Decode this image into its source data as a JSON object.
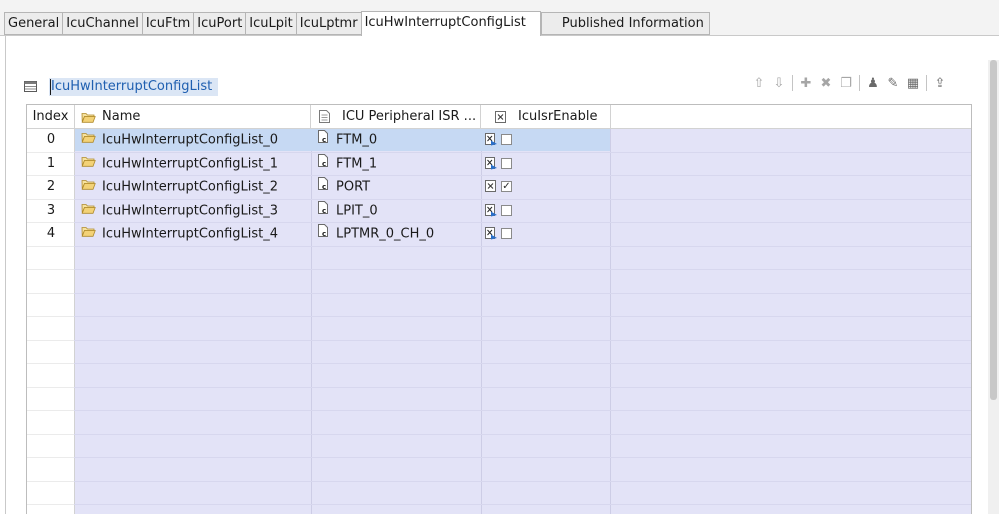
{
  "tabs": [
    {
      "label": "General",
      "active": false
    },
    {
      "label": "IcuChannel",
      "active": false
    },
    {
      "label": "IcuFtm",
      "active": false
    },
    {
      "label": "IcuPort",
      "active": false
    },
    {
      "label": "IcuLpit",
      "active": false
    },
    {
      "label": "IcuLptmr",
      "active": false
    },
    {
      "label": "IcuHwInterruptConfigList",
      "active": true
    },
    {
      "label": "Published Information",
      "active": false
    }
  ],
  "section": {
    "title": "IcuHwInterruptConfigList",
    "icon": "table-icon"
  },
  "toolbar": [
    {
      "icon": "arrow-up-icon",
      "glyph": "⇧",
      "enabled": false
    },
    {
      "icon": "arrow-down-icon",
      "glyph": "⇩",
      "enabled": false
    },
    {
      "icon": "add-icon",
      "glyph": "✚",
      "enabled": false
    },
    {
      "icon": "delete-icon",
      "glyph": "✖",
      "enabled": false
    },
    {
      "icon": "copy-icon",
      "glyph": "❐",
      "enabled": false
    },
    {
      "icon": "user-icon",
      "glyph": "♟",
      "enabled": true
    },
    {
      "icon": "edit-icon",
      "glyph": "✎",
      "enabled": true
    },
    {
      "icon": "edit-table-icon",
      "glyph": "▦",
      "enabled": true
    },
    {
      "icon": "export-icon",
      "glyph": "⇪",
      "enabled": true
    }
  ],
  "table": {
    "columns": {
      "index": "Index",
      "name": "Name",
      "isr": "ICU Peripheral ISR ...",
      "enable": "IcuIsrEnable"
    },
    "rows": [
      {
        "index": "0",
        "name": "IcuHwInterruptConfigList_0",
        "isr": "FTM_0",
        "enabled": false
      },
      {
        "index": "1",
        "name": "IcuHwInterruptConfigList_1",
        "isr": "FTM_1",
        "enabled": false
      },
      {
        "index": "2",
        "name": "IcuHwInterruptConfigList_2",
        "isr": "PORT",
        "enabled": true
      },
      {
        "index": "3",
        "name": "IcuHwInterruptConfigList_3",
        "isr": "LPIT_0",
        "enabled": false
      },
      {
        "index": "4",
        "name": "IcuHwInterruptConfigList_4",
        "isr": "LPTMR_0_CH_0",
        "enabled": false
      }
    ],
    "selected_row": 0
  },
  "colors": {
    "selection": "#c6d9f3",
    "table_fill": "#e3e3f7",
    "title_highlight": "#dbe6f5",
    "title_text": "#1f5fb0"
  }
}
